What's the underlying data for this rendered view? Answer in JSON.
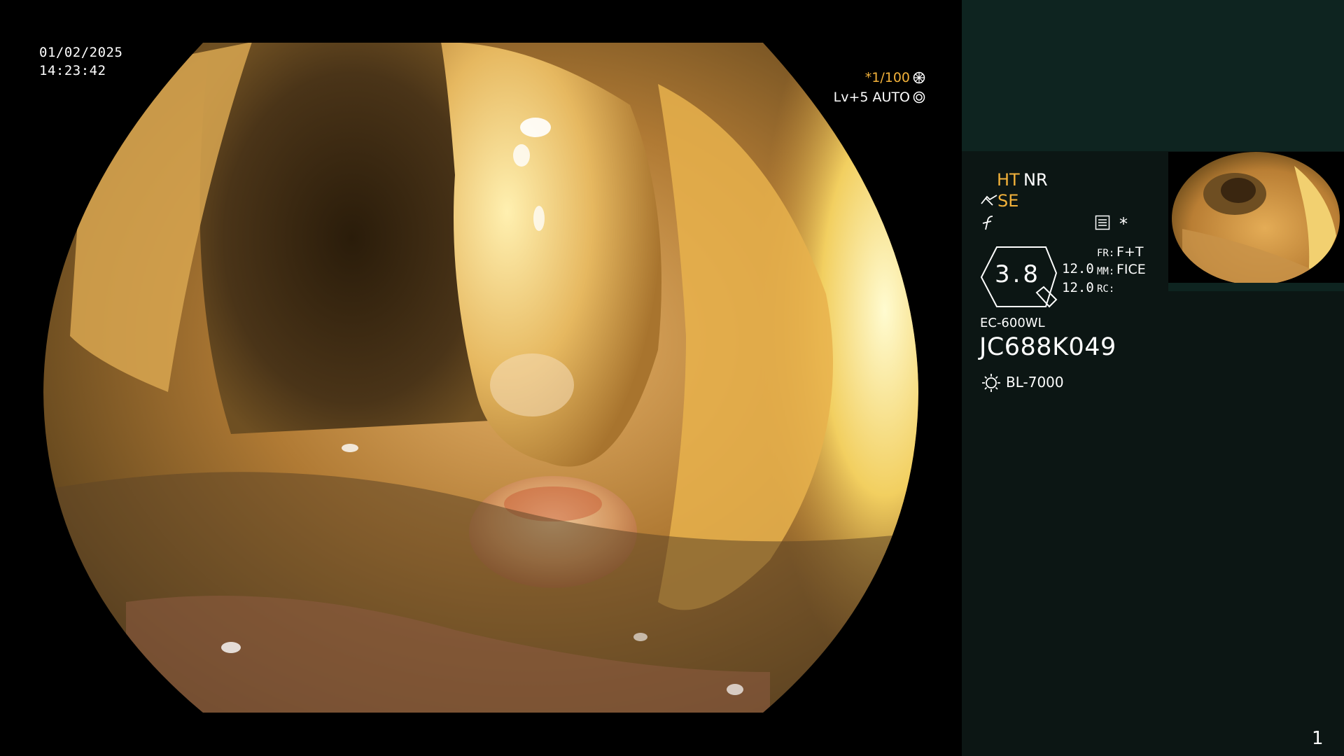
{
  "overlay": {
    "date": "01/02/2025",
    "time": "14:23:42",
    "shutter": "*1/100",
    "level": "Lv+5 AUTO"
  },
  "status": {
    "ht": "HT",
    "nr": "NR",
    "se": "SE",
    "star": "*",
    "magnification": "3.8",
    "value1": "12.0",
    "value2": "12.0",
    "fr_label": "FR:",
    "fr_value": "F+T",
    "mm_label": "MM:",
    "mm_value": "FICE",
    "rc_label": "RC:"
  },
  "device": {
    "model": "EC-600WL",
    "serial": "JC688K049",
    "light_source": "BL-7000"
  },
  "page_number": "1",
  "colors": {
    "accent_orange": "#f2b13a",
    "sidebar_bg": "#0c1614",
    "sidebar_top_bg": "#0e2420"
  },
  "icons": [
    "ring-icon",
    "lens-icon",
    "scissors-icon",
    "f-curve-icon",
    "menu-icon",
    "magnifier-badge-icon",
    "light-icon"
  ]
}
